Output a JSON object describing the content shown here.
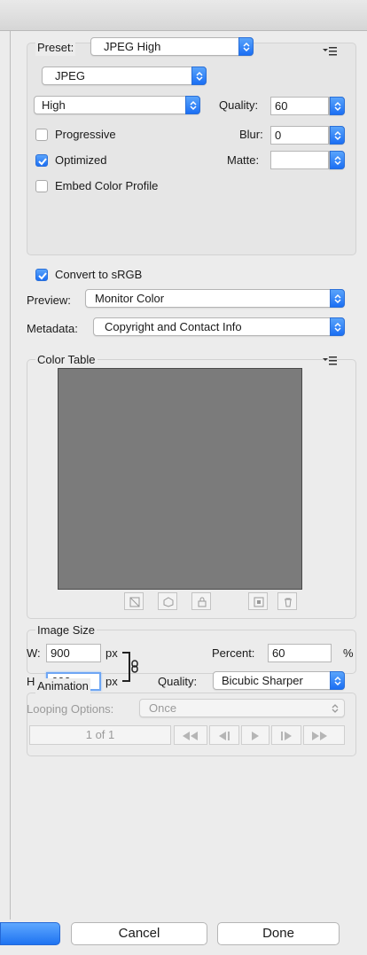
{
  "settings": {
    "preset_label": "Preset:",
    "preset_value": "JPEG High",
    "format_value": "JPEG",
    "quality_preset_value": "High",
    "quality_label": "Quality:",
    "quality_value": "60",
    "progressive_label": "Progressive",
    "progressive_checked": false,
    "blur_label": "Blur:",
    "blur_value": "0",
    "optimized_label": "Optimized",
    "optimized_checked": true,
    "matte_label": "Matte:",
    "matte_value": "",
    "embed_profile_label": "Embed Color Profile",
    "embed_profile_checked": false,
    "convert_srgb_label": "Convert to sRGB",
    "convert_srgb_checked": true,
    "preview_label": "Preview:",
    "preview_value": "Monitor Color",
    "metadata_label": "Metadata:",
    "metadata_value": "Copyright and Contact Info"
  },
  "color_table": {
    "title": "Color Table",
    "swatch_color": "#7b7b7b"
  },
  "image_size": {
    "title": "Image Size",
    "width_label": "W:",
    "width_value": "900",
    "height_label": "H:",
    "height_value": "600",
    "unit": "px",
    "percent_label": "Percent:",
    "percent_value": "60",
    "percent_unit": "%",
    "quality_label": "Quality:",
    "quality_value": "Bicubic Sharper"
  },
  "animation": {
    "title": "Animation",
    "looping_label": "Looping Options:",
    "looping_value": "Once",
    "frame_counter": "1 of 1"
  },
  "footer": {
    "cancel_label": "Cancel",
    "done_label": "Done"
  },
  "colors": {
    "accent": "#1b6ff4",
    "panel": "#ececec"
  }
}
